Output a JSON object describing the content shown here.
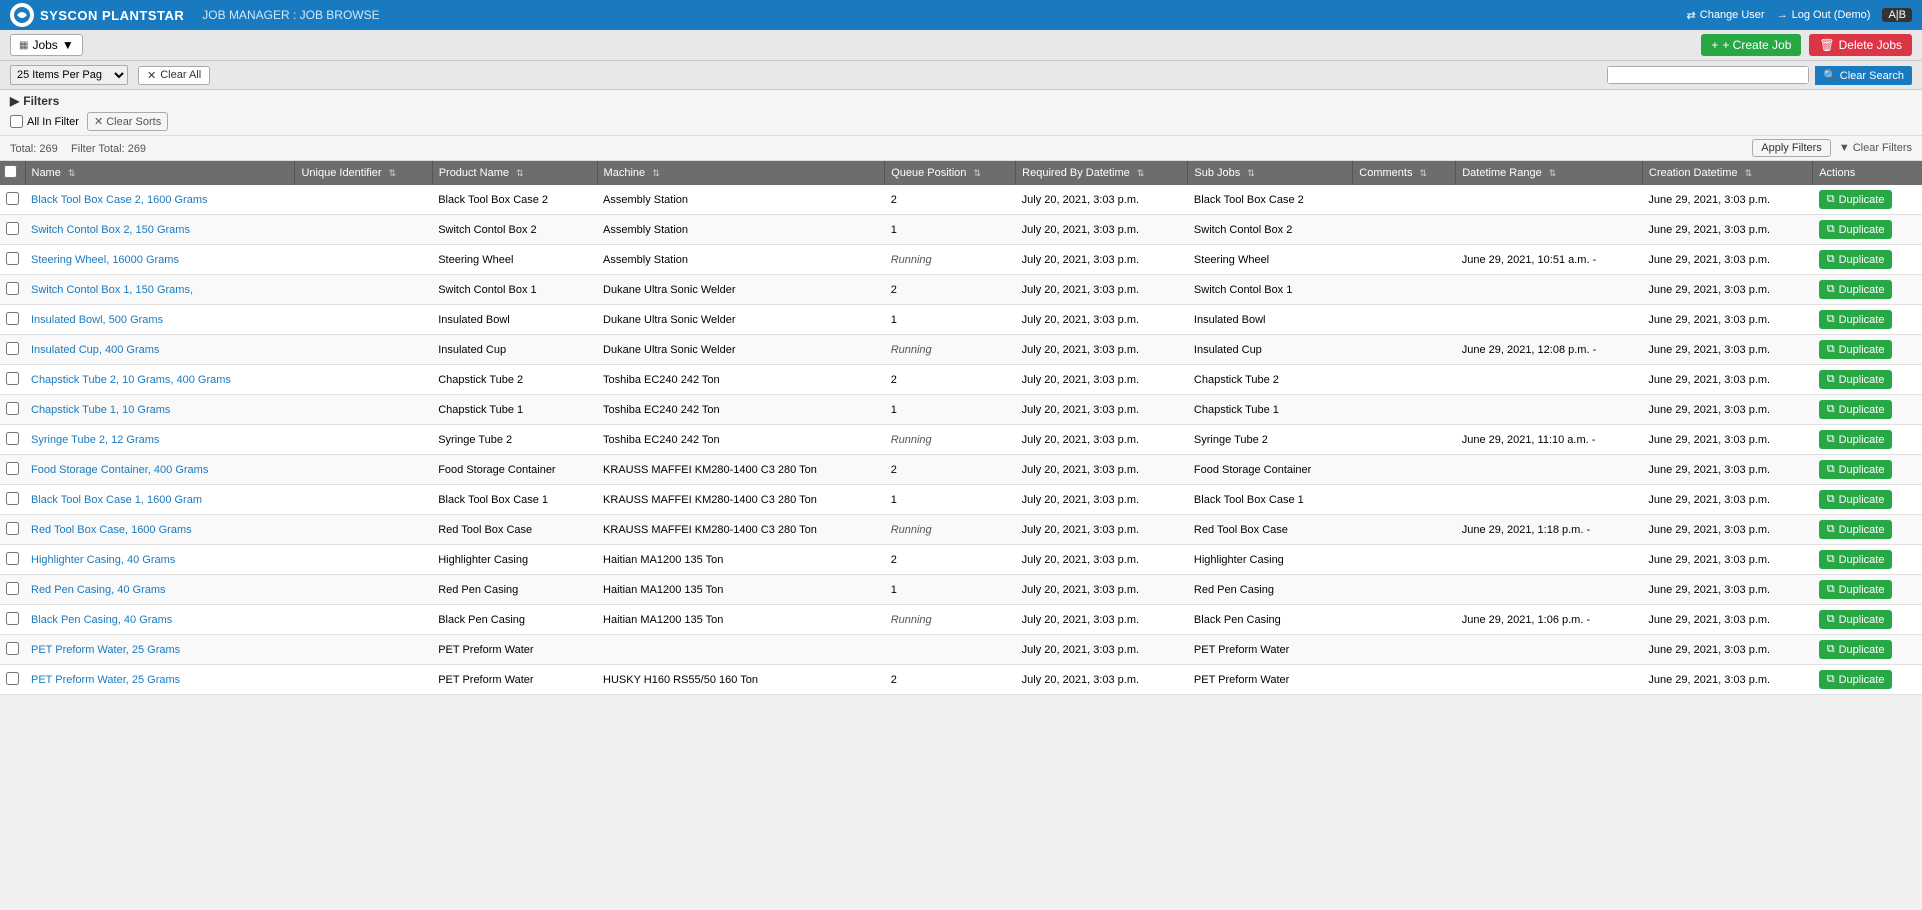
{
  "app": {
    "logo_text": "SYSCON PLANTSTAR",
    "title": "JOB MANAGER : JOB BROWSE",
    "nav_change_user": "Change User",
    "nav_logout": "Log Out (Demo)",
    "user_badge": "A|B"
  },
  "toolbar": {
    "jobs_label": "Jobs",
    "create_job_label": "+ Create Job",
    "delete_jobs_label": "🗑 Delete Jobs"
  },
  "filter_bar": {
    "per_page_label": "25 Items Per Pag",
    "clear_all_label": "Clear All",
    "search_placeholder": "",
    "search_button_label": "Clear Search"
  },
  "filters": {
    "header": "▶ Filters",
    "all_in_filter_label": "All In Filter",
    "clear_sorts_label": "Clear Sorts"
  },
  "stats": {
    "total_label": "Total: 269",
    "filter_total_label": "Filter Total: 269",
    "apply_filters_label": "Apply Filters",
    "clear_filters_label": "▼ Clear Filters"
  },
  "table": {
    "columns": [
      {
        "id": "checkbox",
        "label": ""
      },
      {
        "id": "name",
        "label": "Name"
      },
      {
        "id": "unique_id",
        "label": "Unique Identifier"
      },
      {
        "id": "product_name",
        "label": "Product Name"
      },
      {
        "id": "machine",
        "label": "Machine"
      },
      {
        "id": "queue_position",
        "label": "Queue Position"
      },
      {
        "id": "required_by",
        "label": "Required By Datetime"
      },
      {
        "id": "sub_jobs",
        "label": "Sub Jobs"
      },
      {
        "id": "comments",
        "label": "Comments"
      },
      {
        "id": "datetime_range",
        "label": "Datetime Range"
      },
      {
        "id": "creation_datetime",
        "label": "Creation Datetime"
      },
      {
        "id": "actions",
        "label": "Actions"
      }
    ],
    "rows": [
      {
        "name": "Black Tool Box Case 2, 1600 Grams",
        "unique_id": "",
        "product_name": "Black Tool Box Case 2",
        "machine": "Assembly Station",
        "queue_position": "2",
        "required_by": "July 20, 2021, 3:03 p.m.",
        "sub_jobs": "Black Tool Box Case 2",
        "comments": "",
        "datetime_range": "",
        "creation_datetime": "June 29, 2021, 3:03 p.m.",
        "is_running": false
      },
      {
        "name": "Switch Contol Box 2, 150 Grams",
        "unique_id": "",
        "product_name": "Switch Contol Box 2",
        "machine": "Assembly Station",
        "queue_position": "1",
        "required_by": "July 20, 2021, 3:03 p.m.",
        "sub_jobs": "Switch Contol Box 2",
        "comments": "",
        "datetime_range": "",
        "creation_datetime": "June 29, 2021, 3:03 p.m.",
        "is_running": false
      },
      {
        "name": "Steering Wheel, 16000 Grams",
        "unique_id": "",
        "product_name": "Steering Wheel",
        "machine": "Assembly Station",
        "queue_position": "Running",
        "required_by": "July 20, 2021, 3:03 p.m.",
        "sub_jobs": "Steering Wheel",
        "comments": "",
        "datetime_range": "June 29, 2021, 10:51 a.m. -",
        "creation_datetime": "June 29, 2021, 3:03 p.m.",
        "is_running": true
      },
      {
        "name": "Switch Contol Box 1, 150 Grams,",
        "unique_id": "",
        "product_name": "Switch Contol Box 1",
        "machine": "Dukane Ultra Sonic Welder",
        "queue_position": "2",
        "required_by": "July 20, 2021, 3:03 p.m.",
        "sub_jobs": "Switch Contol Box 1",
        "comments": "",
        "datetime_range": "",
        "creation_datetime": "June 29, 2021, 3:03 p.m.",
        "is_running": false
      },
      {
        "name": "Insulated Bowl, 500 Grams",
        "unique_id": "",
        "product_name": "Insulated Bowl",
        "machine": "Dukane Ultra Sonic Welder",
        "queue_position": "1",
        "required_by": "July 20, 2021, 3:03 p.m.",
        "sub_jobs": "Insulated Bowl",
        "comments": "",
        "datetime_range": "",
        "creation_datetime": "June 29, 2021, 3:03 p.m.",
        "is_running": false
      },
      {
        "name": "Insulated Cup, 400 Grams",
        "unique_id": "",
        "product_name": "Insulated Cup",
        "machine": "Dukane Ultra Sonic Welder",
        "queue_position": "Running",
        "required_by": "July 20, 2021, 3:03 p.m.",
        "sub_jobs": "Insulated Cup",
        "comments": "",
        "datetime_range": "June 29, 2021, 12:08 p.m. -",
        "creation_datetime": "June 29, 2021, 3:03 p.m.",
        "is_running": true
      },
      {
        "name": "Chapstick Tube 2, 10 Grams, 400 Grams",
        "unique_id": "",
        "product_name": "Chapstick Tube 2",
        "machine": "Toshiba EC240 242 Ton",
        "queue_position": "2",
        "required_by": "July 20, 2021, 3:03 p.m.",
        "sub_jobs": "Chapstick Tube 2",
        "comments": "",
        "datetime_range": "",
        "creation_datetime": "June 29, 2021, 3:03 p.m.",
        "is_running": false
      },
      {
        "name": "Chapstick Tube 1, 10 Grams",
        "unique_id": "",
        "product_name": "Chapstick Tube 1",
        "machine": "Toshiba EC240 242 Ton",
        "queue_position": "1",
        "required_by": "July 20, 2021, 3:03 p.m.",
        "sub_jobs": "Chapstick Tube 1",
        "comments": "",
        "datetime_range": "",
        "creation_datetime": "June 29, 2021, 3:03 p.m.",
        "is_running": false
      },
      {
        "name": "Syringe Tube 2, 12 Grams",
        "unique_id": "",
        "product_name": "Syringe Tube 2",
        "machine": "Toshiba EC240 242 Ton",
        "queue_position": "Running",
        "required_by": "July 20, 2021, 3:03 p.m.",
        "sub_jobs": "Syringe Tube 2",
        "comments": "",
        "datetime_range": "June 29, 2021, 11:10 a.m. -",
        "creation_datetime": "June 29, 2021, 3:03 p.m.",
        "is_running": true
      },
      {
        "name": "Food Storage Container, 400 Grams",
        "unique_id": "",
        "product_name": "Food Storage Container",
        "machine": "KRAUSS MAFFEI KM280-1400 C3 280 Ton",
        "queue_position": "2",
        "required_by": "July 20, 2021, 3:03 p.m.",
        "sub_jobs": "Food Storage Container",
        "comments": "",
        "datetime_range": "",
        "creation_datetime": "June 29, 2021, 3:03 p.m.",
        "is_running": false
      },
      {
        "name": "Black Tool Box Case 1, 1600 Gram",
        "unique_id": "",
        "product_name": "Black Tool Box Case 1",
        "machine": "KRAUSS MAFFEI KM280-1400 C3 280 Ton",
        "queue_position": "1",
        "required_by": "July 20, 2021, 3:03 p.m.",
        "sub_jobs": "Black Tool Box Case 1",
        "comments": "",
        "datetime_range": "",
        "creation_datetime": "June 29, 2021, 3:03 p.m.",
        "is_running": false
      },
      {
        "name": "Red Tool Box Case, 1600 Grams",
        "unique_id": "",
        "product_name": "Red Tool Box Case",
        "machine": "KRAUSS MAFFEI KM280-1400 C3 280 Ton",
        "queue_position": "Running",
        "required_by": "July 20, 2021, 3:03 p.m.",
        "sub_jobs": "Red Tool Box Case",
        "comments": "",
        "datetime_range": "June 29, 2021, 1:18 p.m. -",
        "creation_datetime": "June 29, 2021, 3:03 p.m.",
        "is_running": true
      },
      {
        "name": "Highlighter Casing, 40 Grams",
        "unique_id": "",
        "product_name": "Highlighter Casing",
        "machine": "Haitian MA1200 135 Ton",
        "queue_position": "2",
        "required_by": "July 20, 2021, 3:03 p.m.",
        "sub_jobs": "Highlighter Casing",
        "comments": "",
        "datetime_range": "",
        "creation_datetime": "June 29, 2021, 3:03 p.m.",
        "is_running": false
      },
      {
        "name": "Red Pen Casing, 40 Grams",
        "unique_id": "",
        "product_name": "Red Pen Casing",
        "machine": "Haitian MA1200 135 Ton",
        "queue_position": "1",
        "required_by": "July 20, 2021, 3:03 p.m.",
        "sub_jobs": "Red Pen Casing",
        "comments": "",
        "datetime_range": "",
        "creation_datetime": "June 29, 2021, 3:03 p.m.",
        "is_running": false
      },
      {
        "name": "Black Pen Casing, 40 Grams",
        "unique_id": "",
        "product_name": "Black Pen Casing",
        "machine": "Haitian MA1200 135 Ton",
        "queue_position": "Running",
        "required_by": "July 20, 2021, 3:03 p.m.",
        "sub_jobs": "Black Pen Casing",
        "comments": "",
        "datetime_range": "June 29, 2021, 1:06 p.m. -",
        "creation_datetime": "June 29, 2021, 3:03 p.m.",
        "is_running": true
      },
      {
        "name": "PET Preform Water, 25 Grams",
        "unique_id": "",
        "product_name": "PET Preform Water",
        "machine": "",
        "queue_position": "",
        "required_by": "July 20, 2021, 3:03 p.m.",
        "sub_jobs": "PET Preform Water",
        "comments": "",
        "datetime_range": "",
        "creation_datetime": "June 29, 2021, 3:03 p.m.",
        "is_running": false
      },
      {
        "name": "PET Preform Water, 25 Grams",
        "unique_id": "",
        "product_name": "PET Preform Water",
        "machine": "HUSKY H160 RS55/50 160 Ton",
        "queue_position": "2",
        "required_by": "July 20, 2021, 3:03 p.m.",
        "sub_jobs": "PET Preform Water",
        "comments": "",
        "datetime_range": "",
        "creation_datetime": "June 29, 2021, 3:03 p.m.",
        "is_running": false
      }
    ],
    "duplicate_label": "Duplicate"
  }
}
